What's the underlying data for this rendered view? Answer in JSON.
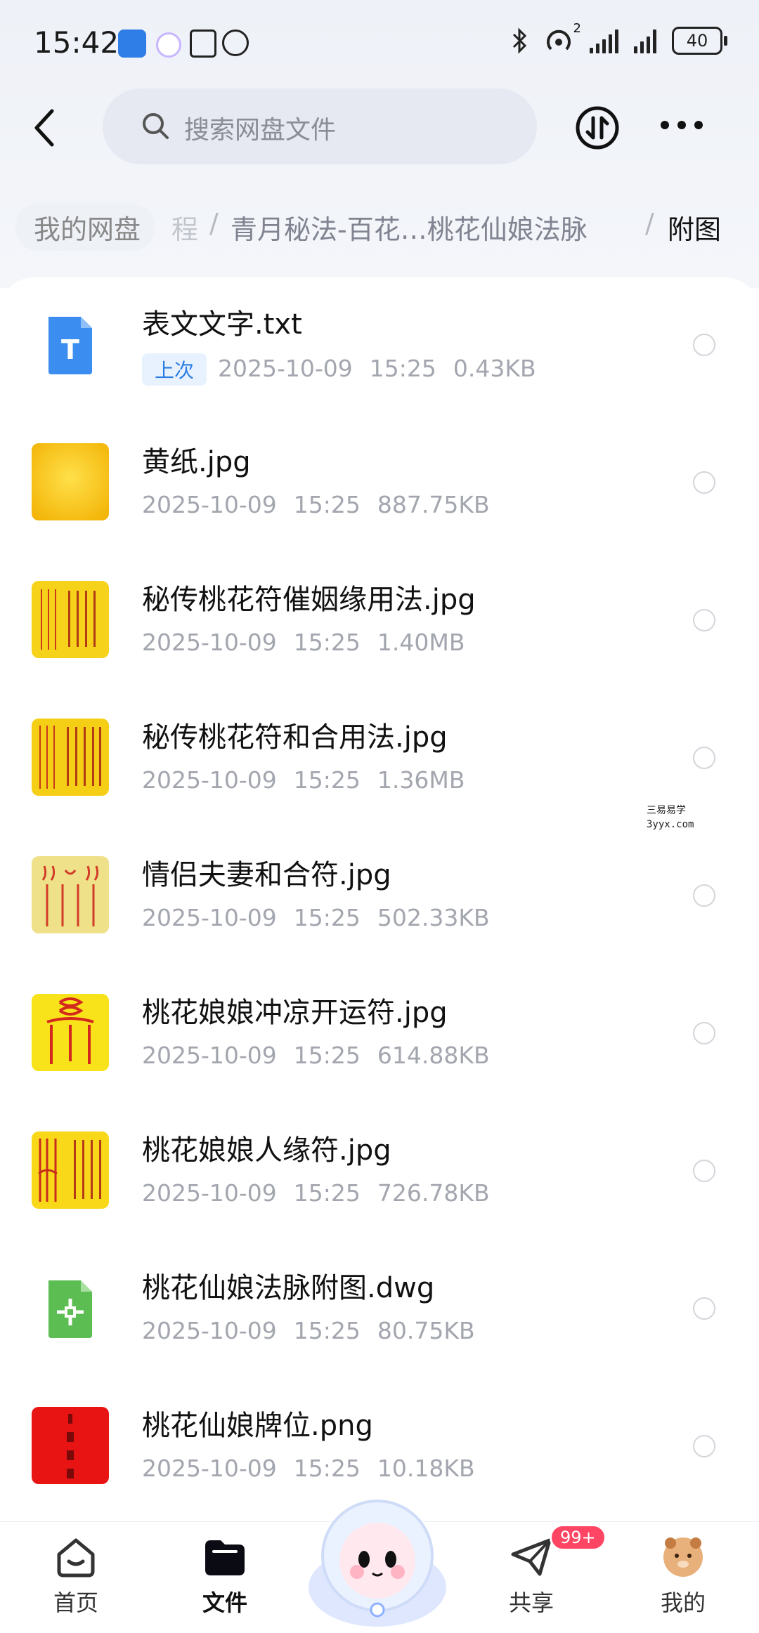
{
  "status_bar": {
    "time": "15:42",
    "signal_superscript": "2",
    "battery": "40"
  },
  "header": {
    "search_placeholder": "搜索网盘文件"
  },
  "breadcrumb": {
    "home": "我的网盘",
    "partial": "程",
    "middle": "青月秘法-百花…桃花仙娘法脉",
    "current": "附图"
  },
  "files": [
    {
      "name": "表文文字.txt",
      "tag": "上次",
      "date": "2025-10-09",
      "time": "15:25",
      "size": "0.43KB",
      "icon": "txt-file-icon"
    },
    {
      "name": "黄纸.jpg",
      "date": "2025-10-09",
      "time": "15:25",
      "size": "887.75KB",
      "icon": "yellow-paper-thumbnail"
    },
    {
      "name": "秘传桃花符催姻缘用法.jpg",
      "date": "2025-10-09",
      "time": "15:25",
      "size": "1.40MB",
      "icon": "talisman-thumbnail"
    },
    {
      "name": "秘传桃花符和合用法.jpg",
      "date": "2025-10-09",
      "time": "15:25",
      "size": "1.36MB",
      "icon": "talisman-thumbnail"
    },
    {
      "name": "情侣夫妻和合符.jpg",
      "date": "2025-10-09",
      "time": "15:25",
      "size": "502.33KB",
      "icon": "talisman-thumbnail"
    },
    {
      "name": "桃花娘娘冲凉开运符.jpg",
      "date": "2025-10-09",
      "time": "15:25",
      "size": "614.88KB",
      "icon": "talisman-thumbnail"
    },
    {
      "name": "桃花娘娘人缘符.jpg",
      "date": "2025-10-09",
      "time": "15:25",
      "size": "726.78KB",
      "icon": "talisman-thumbnail"
    },
    {
      "name": "桃花仙娘法脉附图.dwg",
      "date": "2025-10-09",
      "time": "15:25",
      "size": "80.75KB",
      "icon": "dwg-file-icon"
    },
    {
      "name": "桃花仙娘牌位.png",
      "date": "2025-10-09",
      "time": "15:25",
      "size": "10.18KB",
      "icon": "red-tablet-thumbnail"
    }
  ],
  "watermark": {
    "line1": "三易易学",
    "line2": "3yyx.com"
  },
  "nav": {
    "tabs": [
      {
        "label": "首页"
      },
      {
        "label": "文件"
      },
      {
        "label": "共享"
      },
      {
        "label": "我的"
      }
    ],
    "share_badge": "99+"
  },
  "colors": {
    "accent": "#2a7de1",
    "badge": "#ff4564",
    "yellow": "#f7d21a",
    "red": "#e01818"
  }
}
